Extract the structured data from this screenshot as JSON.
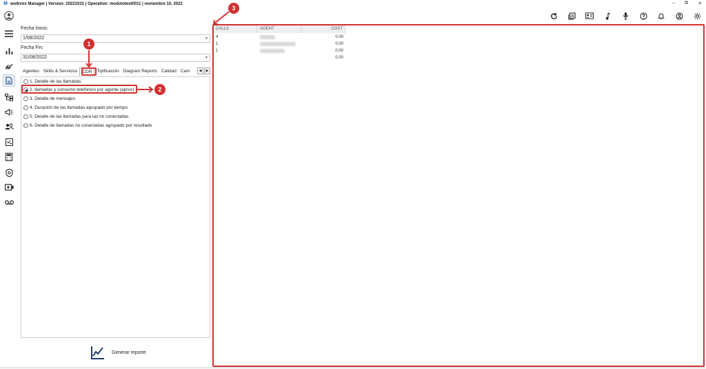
{
  "titlebar": {
    "logo": "M",
    "title": "wolkvox Manager  | Version: 20221031 |  Operation: modulotest0011 | noviembre 10, 2022",
    "minimize": "–",
    "restore": "⧉",
    "close": "✕"
  },
  "filters": {
    "start_label": "Fecha Inicio:",
    "start_value": "1/08/2022",
    "end_label": "Fecha Fin:",
    "end_value": "31/08/2022"
  },
  "tabs": [
    "Agentes",
    "Skills & Servicios",
    "CDR",
    "Tipificación",
    "Diagram Reports",
    "Calidad",
    "Cam"
  ],
  "selected_tab": "CDR",
  "options": [
    "1. Detalle de las llamadas",
    "2. llamadas y consumo telefonico por agente (aprox)",
    "3. Detalle de mensajes",
    "4. Duración de las llamadas agrupado por tiempo",
    "5. Detalle de las llamadas para las no conectadas",
    "6. Detalle de llamadas no conectadas agrupado por resultado"
  ],
  "selected_option_index": 1,
  "generate_label": "Generar reporte",
  "grid": {
    "headers": [
      "CALLS",
      "AGENT",
      "COST"
    ],
    "rows": [
      {
        "calls": "4",
        "cost": "0.00"
      },
      {
        "calls": "1",
        "cost": "0.00"
      },
      {
        "calls": "1",
        "cost": "0.00"
      },
      {
        "calls": "",
        "cost": "0.00"
      }
    ]
  },
  "annotations": {
    "badge1": "1",
    "badge2": "2",
    "badge3": "3",
    "color": "#d32f2f"
  }
}
